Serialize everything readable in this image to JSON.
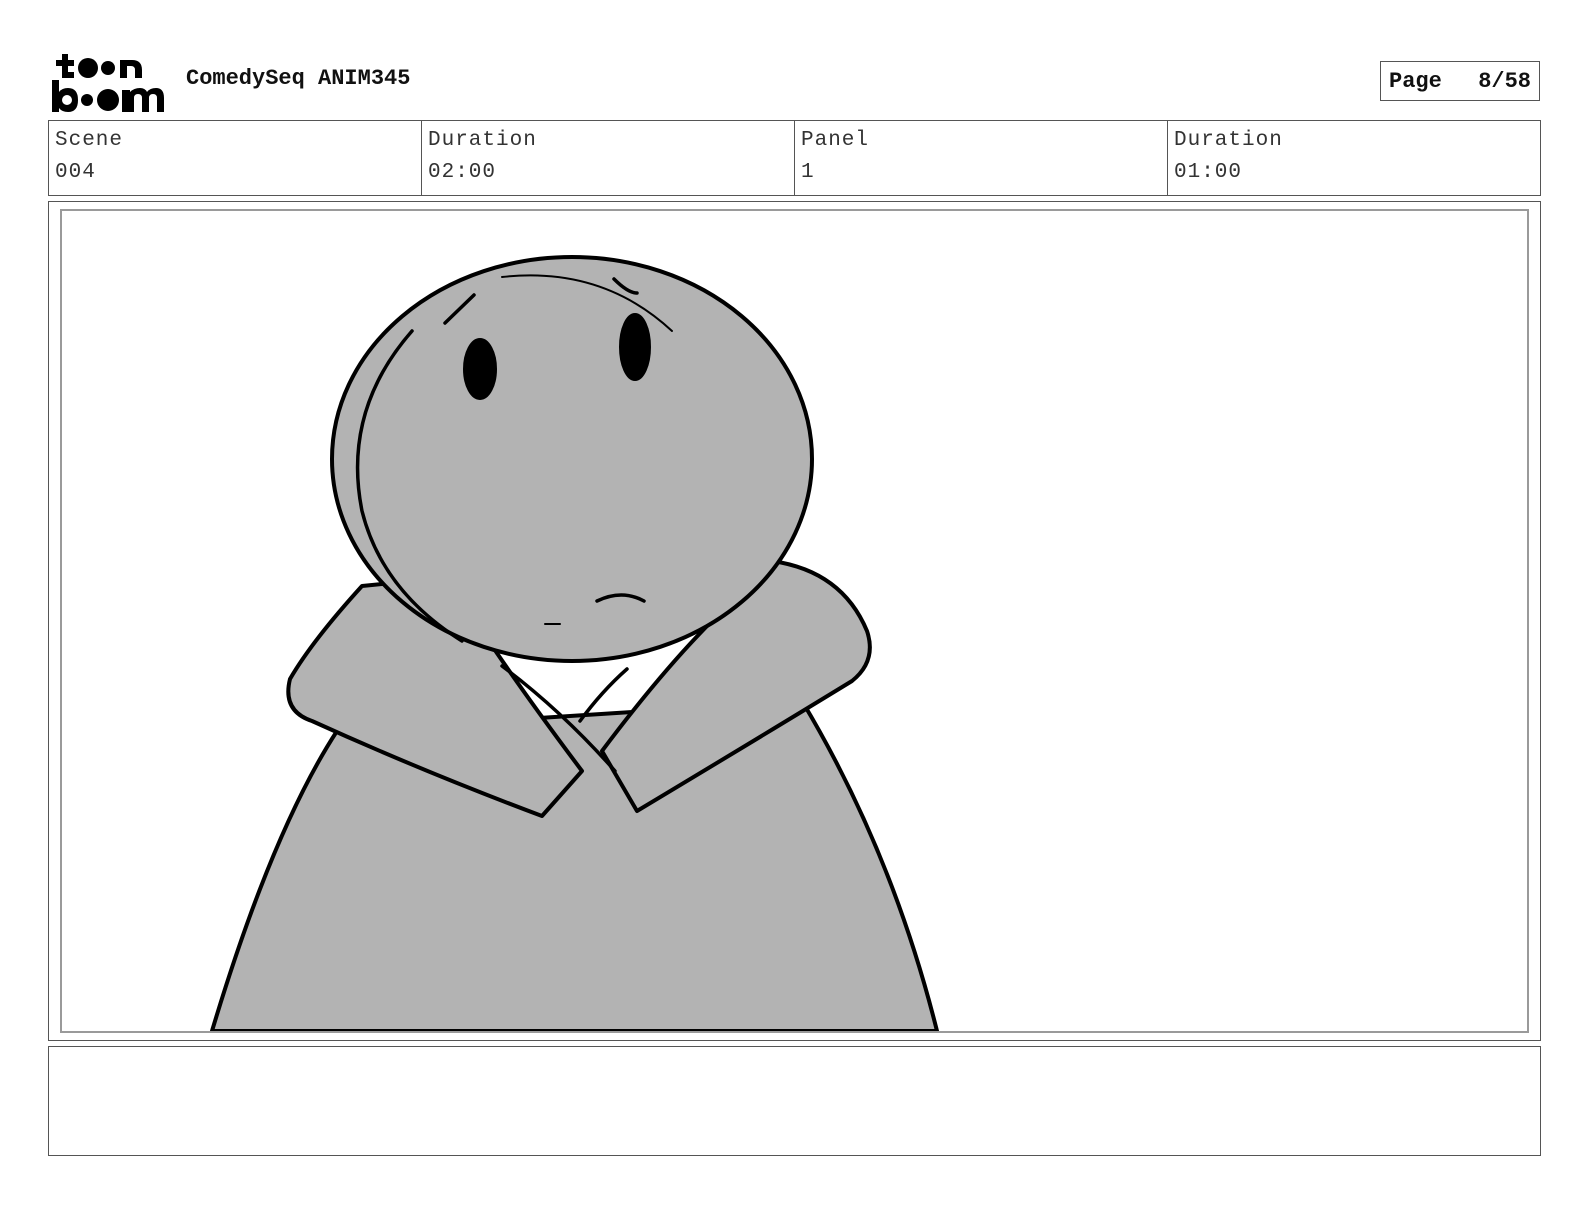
{
  "header": {
    "logo_text_top": "toon",
    "logo_text_bottom": "boom",
    "project_title": "ComedySeq ANIM345",
    "page_label": "Page",
    "page_number": "8/58"
  },
  "info": {
    "scene_label": "Scene",
    "scene_value": "004",
    "scene_duration_label": "Duration",
    "scene_duration_value": "02:00",
    "panel_label": "Panel",
    "panel_value": "1",
    "panel_duration_label": "Duration",
    "panel_duration_value": "01:00"
  },
  "panel": {
    "fill_color": "#b3b3b3",
    "line_color": "#000000"
  },
  "notes": {
    "text": ""
  }
}
